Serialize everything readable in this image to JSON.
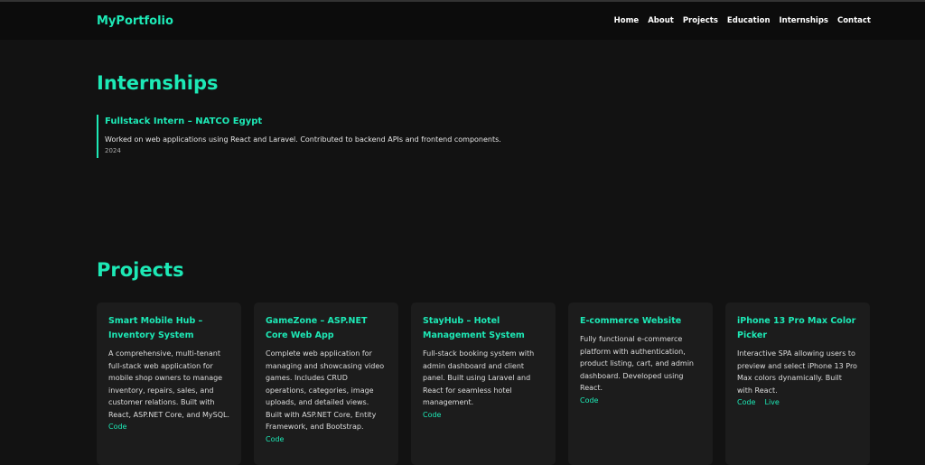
{
  "nav": {
    "logo": "MyPortfolio",
    "links": [
      "Home",
      "About",
      "Projects",
      "Education",
      "Internships",
      "Contact"
    ]
  },
  "internships": {
    "heading": "Internships",
    "items": [
      {
        "title": "Fullstack Intern – NATCO Egypt",
        "desc": "Worked on web applications using React and Laravel. Contributed to backend APIs and frontend components.",
        "year": "2024"
      }
    ]
  },
  "projects": {
    "heading": "Projects",
    "items": [
      {
        "title": "Smart Mobile Hub – Inventory System",
        "desc": "A comprehensive, multi-tenant full-stack web application for mobile shop owners to manage inventory, repairs, sales, and customer relations. Built with React, ASP.NET Core, and MySQL.",
        "links": [
          "Code"
        ]
      },
      {
        "title": "GameZone – ASP.NET Core Web App",
        "desc": "Complete web application for managing and showcasing video games. Includes CRUD operations, categories, image uploads, and detailed views. Built with ASP.NET Core, Entity Framework, and Bootstrap.",
        "links": [
          "Code"
        ]
      },
      {
        "title": "StayHub – Hotel Management System",
        "desc": "Full-stack booking system with admin dashboard and client panel. Built using Laravel and React for seamless hotel management.",
        "links": [
          "Code"
        ]
      },
      {
        "title": "E-commerce Website",
        "desc": "Fully functional e-commerce platform with authentication, product listing, cart, and admin dashboard. Developed using React.",
        "links": [
          "Code"
        ]
      },
      {
        "title": "iPhone 13 Pro Max Color Picker",
        "desc": "Interactive SPA allowing users to preview and select iPhone 13 Pro Max colors dynamically. Built with React.",
        "links": [
          "Code",
          "Live"
        ]
      }
    ]
  }
}
